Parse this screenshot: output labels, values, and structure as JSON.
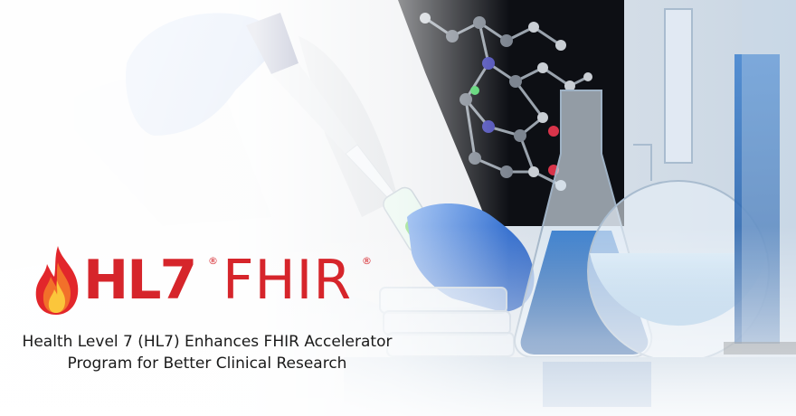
{
  "logo": {
    "primary": "HL7",
    "secondary": "FHIR",
    "registered_mark": "®"
  },
  "headline": {
    "line_1": "Health Level 7 (HL7) Enhances FHIR Accelerator",
    "line_2": "Program for Better Clinical Research"
  },
  "colors": {
    "brand_red": "#d6252b",
    "glove_blue": "#2f6fd6",
    "liquid_blue": "#2563b0",
    "vial_green": "#5fd04a",
    "text": "#1a1a1a"
  }
}
